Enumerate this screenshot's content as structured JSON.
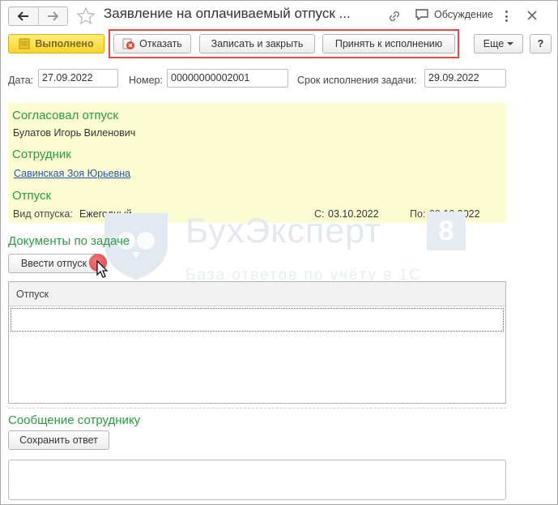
{
  "window": {
    "title": "Заявление на оплачиваемый отпуск ...",
    "discussion_label": "Обсуждение"
  },
  "toolbar": {
    "done_label": "Выполнено",
    "refuse_label": "Отказать",
    "save_close_label": "Записать и закрыть",
    "accept_label": "Принять к исполнению",
    "more_label": "Еще",
    "help_label": "?"
  },
  "fields": {
    "date_label": "Дата:",
    "date_value": "27.09.2022",
    "number_label": "Номер:",
    "number_value": "00000000002001",
    "due_label": "Срок исполнения задачи:",
    "due_value": "29.09.2022"
  },
  "panel": {
    "approved_heading": "Согласовал отпуск",
    "approved_name": "Булатов Игорь Виленович",
    "employee_heading": "Сотрудник",
    "employee_name": "Савинская Зоя Юрьевна",
    "vacation_heading": "Отпуск",
    "vacation_type_label": "Вид отпуска:",
    "vacation_type_value": "Ежегодный",
    "from_label": "С:",
    "from_value": "03.10.2022",
    "to_label": "По:",
    "to_value": "09.10.2022"
  },
  "watermark": {
    "title": "БухЭксперт",
    "number": "8",
    "subtitle": "База ответов по учёту в 1С"
  },
  "documents": {
    "heading": "Документы по задаче",
    "enter_button": "Ввести отпуск",
    "column_header": "Отпуск"
  },
  "message": {
    "heading": "Сообщение сотруднику",
    "save_button": "Сохранить ответ"
  },
  "colors": {
    "accent_green": "#2c9a45",
    "panel_yellow": "#fcfcd2",
    "highlight_red": "#e24a4a",
    "done_yellow": "#f6d428"
  }
}
